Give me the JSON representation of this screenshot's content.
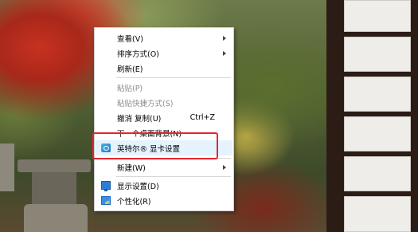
{
  "context_menu": {
    "items": [
      {
        "label": "查看(V)",
        "submenu": true
      },
      {
        "label": "排序方式(O)",
        "submenu": true
      },
      {
        "label": "刷新(E)"
      },
      {
        "label": "粘贴(P)",
        "disabled": true
      },
      {
        "label": "粘贴快捷方式(S)",
        "disabled": true
      },
      {
        "label": "撤消 复制(U)",
        "shortcut": "Ctrl+Z"
      },
      {
        "label": "下一个桌面背景(N)"
      },
      {
        "label": "英特尔® 显卡设置",
        "icon": "intel-graphics-icon",
        "highlighted": true
      },
      {
        "label": "新建(W)",
        "submenu": true
      },
      {
        "label": "显示设置(D)",
        "icon": "display-settings-icon"
      },
      {
        "label": "个性化(R)",
        "icon": "personalize-icon"
      }
    ]
  },
  "annotation": {
    "color": "#e3262f"
  }
}
